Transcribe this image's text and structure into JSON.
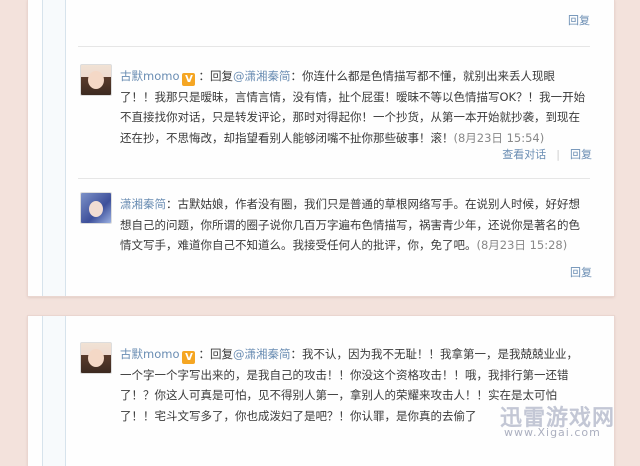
{
  "card1": {
    "top_reply": "回复",
    "comment1": {
      "user": "古默momo",
      "v_badge": "V",
      "reply_prefix": "：回复",
      "target": "@潇湘秦简",
      "content": "：你连什么都是色情描写都不懂，就别出来丢人现眼了！！我那只是暧昧，言情言情，没有情，扯个屁蛋！暧昧不等以色情描写OK？！我一开始不直接找你对话，只是转发评论，那时对得起你！一个抄货，从第一本开始就抄袭，到现在还在抄，不思悔改，却指望看别人能够闭嘴不扯你那些破事！滚！",
      "time": "(8月23日 15:54)",
      "view_thread": "查看对话",
      "reply": "回复"
    },
    "comment2": {
      "user": "潇湘秦简",
      "content": "：古默姑娘，作者没有圈，我们只是普通的草根网络写手。在说别人时候，好好想想自己的问题，你所谓的圈子说你几百万字遍布色情描写，祸害青少年，还说你是著名的色情文写手，难道你自己不知道么。我接受任何人的批评，你，免了吧。",
      "time": "(8月23日 15:28)",
      "reply": "回复"
    }
  },
  "card2": {
    "comment": {
      "user": "古默momo",
      "v_badge": "V",
      "reply_prefix": "：回复",
      "target": "@潇湘秦简",
      "content": "：我不认，因为我不无耻！！我拿第一，是我兢兢业业，一个字一个字写出来的，是我自己的攻击！！你没这个资格攻击！！哦，我排行第一还错了！？你这人可真是可怕，见不得别人第一，拿别人的荣耀来攻击人！！实在是太可怕了！！宅斗文写多了，你也成泼妇了是吧？！你认罪，是你真的去偷了"
    }
  },
  "watermark": {
    "text": "迅雷游戏网",
    "url": "www.Xigai.com"
  }
}
